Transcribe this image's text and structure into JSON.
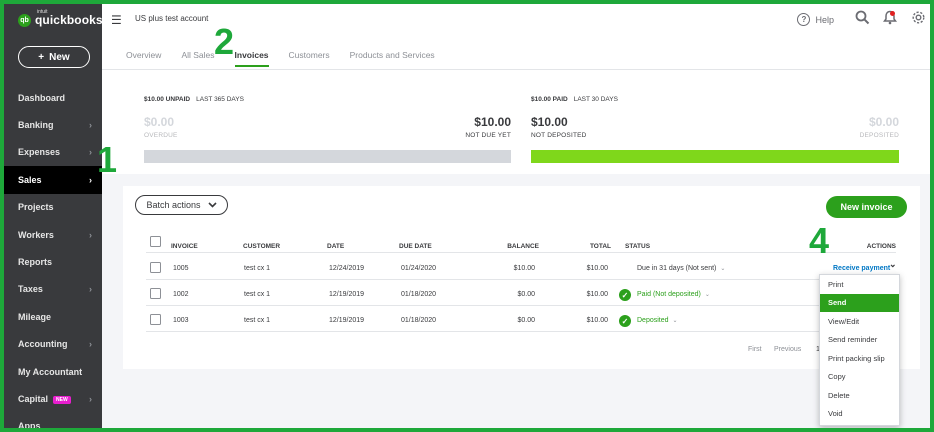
{
  "brand": {
    "logo_small": "intuit",
    "logo_text": "quickbooks",
    "logo_mark": "qb"
  },
  "sidebar": {
    "new_label": "New",
    "items": [
      {
        "label": "Dashboard",
        "chevron": false,
        "active": false
      },
      {
        "label": "Banking",
        "chevron": true,
        "active": false
      },
      {
        "label": "Expenses",
        "chevron": true,
        "active": false
      },
      {
        "label": "Sales",
        "chevron": true,
        "active": true
      },
      {
        "label": "Projects",
        "chevron": false,
        "active": false
      },
      {
        "label": "Workers",
        "chevron": true,
        "active": false
      },
      {
        "label": "Reports",
        "chevron": false,
        "active": false
      },
      {
        "label": "Taxes",
        "chevron": true,
        "active": false
      },
      {
        "label": "Mileage",
        "chevron": false,
        "active": false
      },
      {
        "label": "Accounting",
        "chevron": true,
        "active": false
      },
      {
        "label": "My Accountant",
        "chevron": false,
        "active": false
      },
      {
        "label": "Capital",
        "chevron": true,
        "active": false,
        "badge": "NEW"
      },
      {
        "label": "Apps",
        "chevron": false,
        "active": false
      }
    ]
  },
  "header": {
    "company": "US plus test account",
    "help_label": "Help",
    "tabs": [
      {
        "label": "Overview",
        "active": false
      },
      {
        "label": "All Sales",
        "active": false
      },
      {
        "label": "Invoices",
        "active": true
      },
      {
        "label": "Customers",
        "active": false
      },
      {
        "label": "Products and Services",
        "active": false
      }
    ]
  },
  "summary": {
    "unpaid": {
      "amount_label": "$10.00 UNPAID",
      "period": "LAST 365 DAYS",
      "overdue_amount": "$0.00",
      "overdue_label": "OVERDUE",
      "not_due_amount": "$10.00",
      "not_due_label": "NOT DUE YET",
      "bar_fill_fraction": 0
    },
    "paid": {
      "amount_label": "$10.00 PAID",
      "period": "LAST 30 DAYS",
      "not_deposited_amount": "$10.00",
      "not_deposited_label": "NOT DEPOSITED",
      "deposited_amount": "$0.00",
      "deposited_label": "DEPOSITED",
      "bar_fill_fraction": 1
    }
  },
  "toolbar": {
    "batch_label": "Batch actions",
    "new_invoice_label": "New invoice"
  },
  "table": {
    "columns": [
      "INVOICE",
      "CUSTOMER",
      "DATE",
      "DUE DATE",
      "BALANCE",
      "TOTAL",
      "STATUS",
      "ACTIONS"
    ],
    "rows": [
      {
        "invoice": "1005",
        "customer": "test cx 1",
        "date": "12/24/2019",
        "due_date": "01/24/2020",
        "balance": "$10.00",
        "total": "$10.00",
        "status": "Due in 31 days (Not sent)",
        "status_icon": false
      },
      {
        "invoice": "1002",
        "customer": "test cx 1",
        "date": "12/19/2019",
        "due_date": "01/18/2020",
        "balance": "$0.00",
        "total": "$10.00",
        "status": "Paid (Not deposited)",
        "status_icon": true
      },
      {
        "invoice": "1003",
        "customer": "test cx 1",
        "date": "12/19/2019",
        "due_date": "01/18/2020",
        "balance": "$0.00",
        "total": "$10.00",
        "status": "Deposited",
        "status_icon": true
      }
    ],
    "row_action": "Receive payment"
  },
  "pagination": {
    "first": "First",
    "previous": "Previous",
    "page": "1"
  },
  "action_menu": {
    "items": [
      "Print",
      "Send",
      "View/Edit",
      "Send reminder",
      "Print packing slip",
      "Copy",
      "Delete",
      "Void"
    ],
    "highlighted": "Send"
  },
  "callouts": [
    "1",
    "2",
    "4"
  ],
  "colors": {
    "sidebar": "#393a3d",
    "accent_green": "#2ca01c",
    "paid_bar": "#7fd71b",
    "link_blue": "#0077c5",
    "callout_green": "#1ea83a",
    "frame": "#1ea83a"
  }
}
